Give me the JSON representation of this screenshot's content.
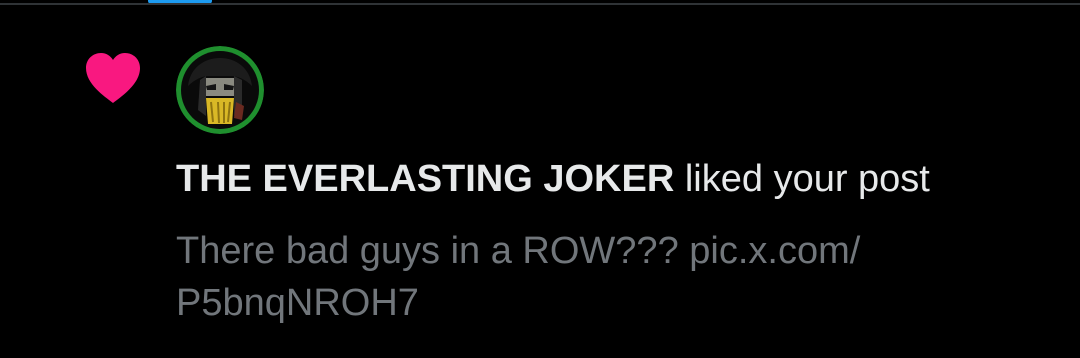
{
  "notification": {
    "type_icon": "heart-icon",
    "user_name": "THE EVERLASTING JOKER",
    "action_text": " liked your post",
    "post_text": "There bad guys in a ROW??? pic.x.com/",
    "post_link": "P5bnqNROH7"
  },
  "colors": {
    "background": "#000000",
    "heart": "#f91880",
    "primary_text": "#e7e9ea",
    "secondary_text": "#71767b",
    "accent": "#1d9bf0",
    "avatar_ring": "#1f8f2e"
  }
}
